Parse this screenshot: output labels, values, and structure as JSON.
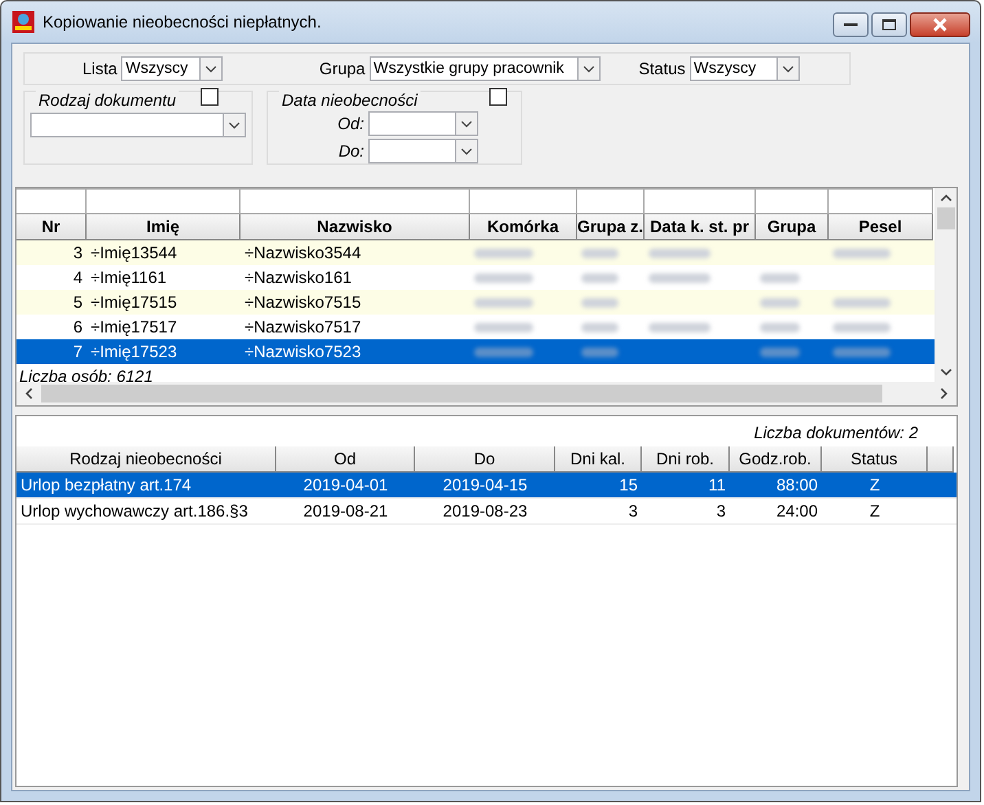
{
  "window": {
    "title": "Kopiowanie nieobecności niepłatnych."
  },
  "filters": {
    "lista": {
      "label": "Lista",
      "value": "Wszyscy"
    },
    "grupa": {
      "label": "Grupa",
      "value": "Wszystkie grupy pracownik"
    },
    "status": {
      "label": "Status",
      "value": "Wszyscy"
    }
  },
  "rodzaj_dokumentu": {
    "title": "Rodzaj dokumentu",
    "checked": false
  },
  "data_nieobecnosci": {
    "title": "Data nieobecności",
    "checked": false,
    "od_label": "Od:",
    "do_label": "Do:"
  },
  "persons": {
    "columns": [
      "Nr",
      "Imię",
      "Nazwisko",
      "Komórka",
      "Grupa z.",
      "Data k. st. pr",
      "Grupa",
      "Pesel"
    ],
    "rows": [
      {
        "nr": "3",
        "imie": "÷Imię13544",
        "nazwisko": "÷Nazwisko3544",
        "hidden_cells": [
          true,
          true,
          true,
          false,
          true
        ],
        "selected": false
      },
      {
        "nr": "4",
        "imie": "÷Imię1161",
        "nazwisko": "÷Nazwisko161",
        "hidden_cells": [
          true,
          true,
          true,
          true,
          false
        ],
        "selected": false
      },
      {
        "nr": "5",
        "imie": "÷Imię17515",
        "nazwisko": "÷Nazwisko7515",
        "hidden_cells": [
          true,
          true,
          false,
          true,
          true
        ],
        "selected": false
      },
      {
        "nr": "6",
        "imie": "÷Imię17517",
        "nazwisko": "÷Nazwisko7517",
        "hidden_cells": [
          true,
          true,
          true,
          true,
          true
        ],
        "selected": false
      },
      {
        "nr": "7",
        "imie": "÷Imię17523",
        "nazwisko": "÷Nazwisko7523",
        "hidden_cells": [
          true,
          true,
          false,
          true,
          true
        ],
        "selected": true
      }
    ],
    "count": "Liczba osób: 6121"
  },
  "documents": {
    "count": "Liczba dokumentów: 2",
    "columns": [
      "Rodzaj nieobecności",
      "Od",
      "Do",
      "Dni kal.",
      "Dni rob.",
      "Godz.rob.",
      "Status"
    ],
    "rows": [
      {
        "cells": [
          "Urlop bezpłatny art.174",
          "2019-04-01",
          "2019-04-15",
          "15",
          "11",
          "88:00",
          "Z"
        ],
        "selected": true
      },
      {
        "cells": [
          "Urlop wychowawczy art.186.§3",
          "2019-08-21",
          "2019-08-23",
          "3",
          "3",
          "24:00",
          "Z"
        ],
        "selected": false
      }
    ]
  }
}
